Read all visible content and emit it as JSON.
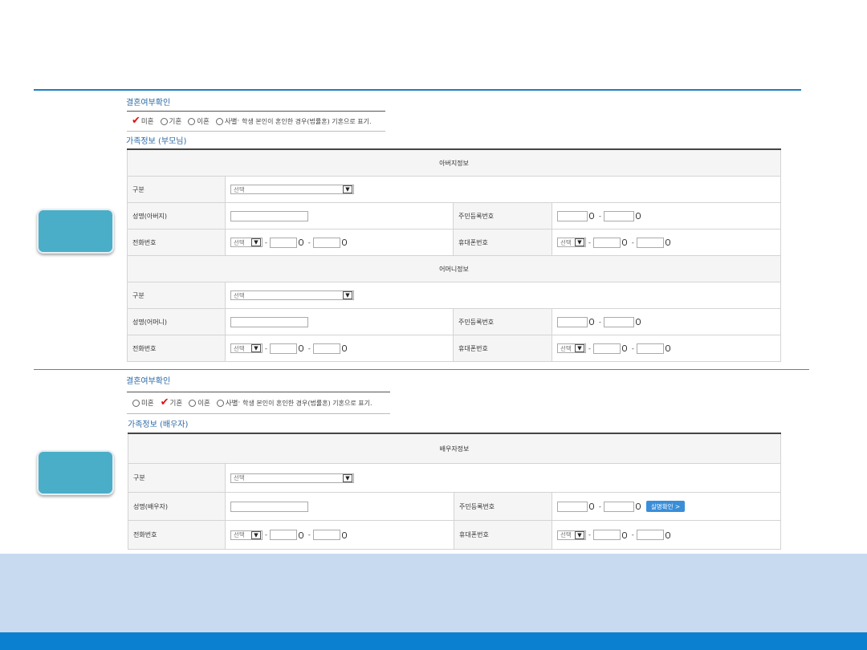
{
  "section1": {
    "marriage_title": "결혼여부확인",
    "options": [
      "미혼",
      "기혼",
      "이혼",
      "사별"
    ],
    "selected": "미혼",
    "note": "학생 본인이 혼인한 경우(법률혼) 기혼으로 표기.",
    "family_title": "가족정보 (부모님)",
    "father_header": "아버지정보",
    "mother_header": "어머니정보",
    "labels": {
      "category": "구분",
      "name_father": "성명(아버지)",
      "name_mother": "성명(어머니)",
      "rrn": "주민등록번호",
      "phone": "전화번호",
      "mobile": "휴대폰번호"
    },
    "select_placeholder": "선택"
  },
  "section2": {
    "marriage_title": "결혼여부확인",
    "options": [
      "미혼",
      "기혼",
      "이혼",
      "사별"
    ],
    "selected": "기혼",
    "note": "학생 본인이 혼인한 경우(법률혼) 기혼으로 표기.",
    "family_title": "가족정보 (배우자)",
    "spouse_header": "배우자정보",
    "labels": {
      "category": "구분",
      "name_spouse": "성명(배우자)",
      "rrn": "주민등록번호",
      "phone": "전화번호",
      "mobile": "휴대폰번호"
    },
    "select_placeholder": "선택",
    "verify_button": "실명확인 >"
  },
  "colors": {
    "accent": "#1b7fc4",
    "side_button": "#4aaec8",
    "footer_band": "#c8daf0",
    "footer_bar": "#0b7fd0",
    "check": "#dd1111"
  }
}
